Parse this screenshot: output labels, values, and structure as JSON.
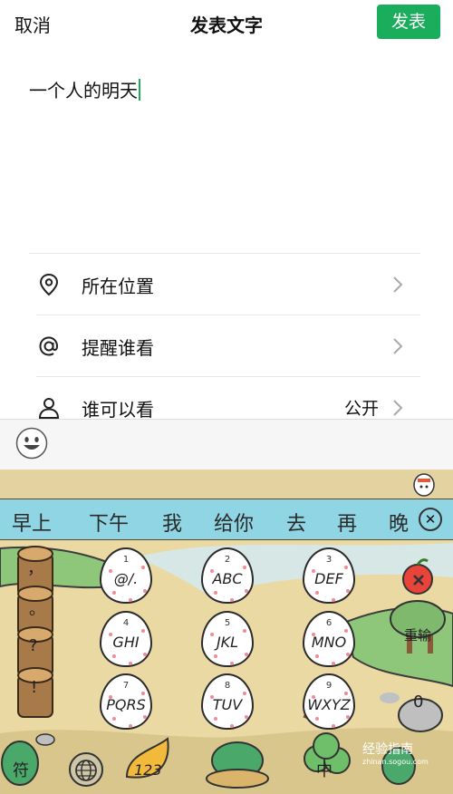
{
  "header": {
    "cancel": "取消",
    "title": "发表文字",
    "publish": "发表"
  },
  "compose": {
    "text": "一个人的明天"
  },
  "options": [
    {
      "label": "所在位置",
      "value": "",
      "icon": "location-pin-icon"
    },
    {
      "label": "提醒谁看",
      "value": "",
      "icon": "at-icon"
    },
    {
      "label": "谁可以看",
      "value": "公开",
      "icon": "person-icon"
    }
  ],
  "keyboard": {
    "candidates": [
      "早上",
      "下午",
      "我",
      "给你",
      "去",
      "再",
      "晚"
    ],
    "keys": [
      {
        "num": "1",
        "letters": "@/."
      },
      {
        "num": "2",
        "letters": "ABC"
      },
      {
        "num": "3",
        "letters": "DEF"
      },
      {
        "num": "4",
        "letters": "GHI"
      },
      {
        "num": "5",
        "letters": "JKL"
      },
      {
        "num": "6",
        "letters": "MNO"
      },
      {
        "num": "7",
        "letters": "PQRS"
      },
      {
        "num": "8",
        "letters": "TUV"
      },
      {
        "num": "9",
        "letters": "WXYZ"
      }
    ],
    "left_keys": [
      "，",
      "。",
      "?",
      "!"
    ],
    "reenter": "重输",
    "zero": "0",
    "symbol": "符",
    "num_switch": "123",
    "lang": "中",
    "colors": {
      "candidate_bar": "#8fd5e3",
      "ground": "#e8d9a6",
      "grass": "#8fc77a",
      "path": "#d7e7e6"
    }
  },
  "watermark": {
    "text": "经验指南",
    "sub": "zhinan.sogou.com"
  },
  "colors": {
    "accent": "#1aad5c"
  }
}
